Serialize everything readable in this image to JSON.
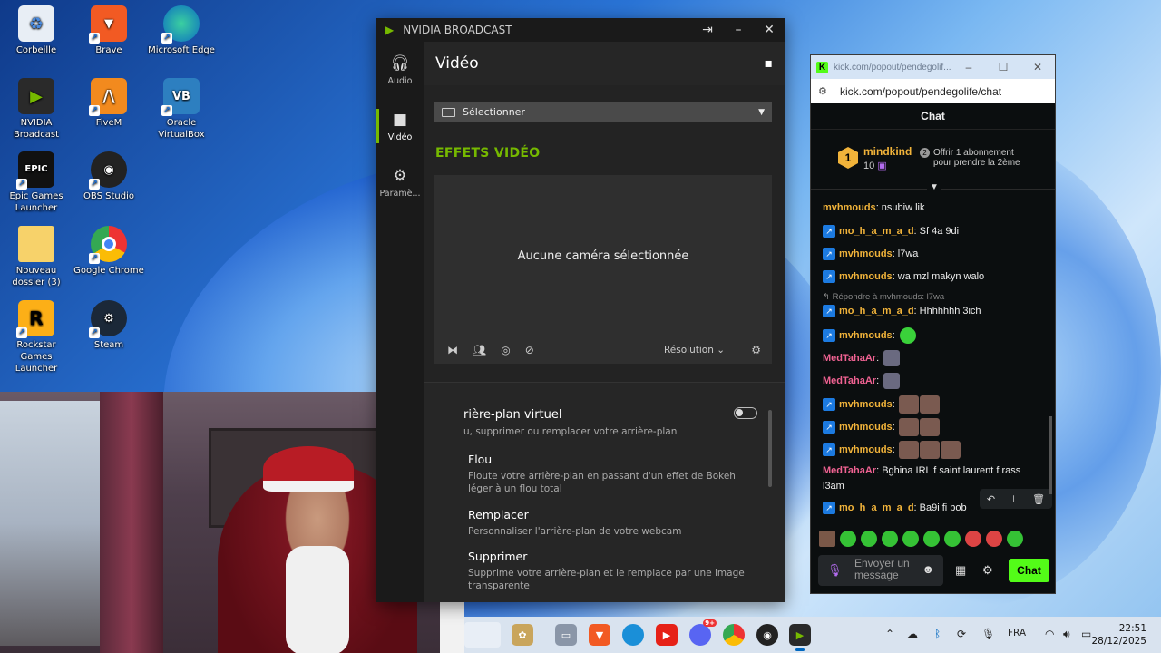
{
  "desktop": {
    "icons": [
      {
        "label": "Corbeille"
      },
      {
        "label": "Brave"
      },
      {
        "label": "Microsoft Edge"
      },
      {
        "label": "NVIDIA Broadcast"
      },
      {
        "label": "FiveM"
      },
      {
        "label": "Oracle VirtualBox"
      },
      {
        "label": "Epic Games Launcher"
      },
      {
        "label": "OBS Studio"
      },
      {
        "label": "Nouveau dossier (3)"
      },
      {
        "label": "Google Chrome"
      },
      {
        "label": "Rockstar Games Launcher"
      },
      {
        "label": "Steam"
      }
    ]
  },
  "nvidia": {
    "title": "NVIDIA BROADCAST",
    "nav": [
      {
        "label": "Audio",
        "icon": "headphones-icon"
      },
      {
        "label": "Vidéo",
        "icon": "camera-icon"
      },
      {
        "label": "Paramè...",
        "icon": "gear-icon"
      }
    ],
    "page_title": "Vidéo",
    "source_select": "Sélectionner",
    "section": "EFFETS VIDÉO",
    "no_camera": "Aucune caméra sélectionnée",
    "resolution": "Résolution",
    "bg_title": "rière-plan virtuel",
    "bg_sub": "u, supprimer ou remplacer votre arrière-plan",
    "options": [
      {
        "title": "Flou",
        "desc": "Floute votre arrière-plan en passant d'un effet de Bokeh léger à un flou total"
      },
      {
        "title": "Remplacer",
        "desc": "Personnaliser l'arrière-plan de votre webcam"
      },
      {
        "title": "Supprimer",
        "desc": "Supprime votre arrière-plan et le remplace par une image transparente"
      }
    ]
  },
  "kick": {
    "tab_title": "kick.com/popout/pendegolif...",
    "url": "kick.com/popout/pendegolife/chat",
    "chat_title": "Chat",
    "promo": {
      "rank": "1",
      "name": "mindkind",
      "count": "10",
      "gift_num": "2",
      "gift_line1": "Offrir 1 abonnement",
      "gift_line2": "pour prendre la 2ème"
    },
    "messages": [
      {
        "user": "mvhmouds",
        "text": " nsubiw lik",
        "color": "#f1b33a",
        "badge": false
      },
      {
        "user": "mo_h_a_m_a_d",
        "text": " Sf 4a 9di",
        "color": "#f1b33a",
        "badge": true
      },
      {
        "user": "mvhmouds",
        "text": " l7wa",
        "color": "#f1b33a",
        "badge": true
      },
      {
        "user": "mvhmouds",
        "text": " wa mzl makyn walo",
        "color": "#f1b33a",
        "badge": true
      },
      {
        "user": "mo_h_a_m_a_d",
        "text": " Hhhhhhh 3ich",
        "color": "#f1b33a",
        "badge": true
      },
      {
        "user": "mvhmouds",
        "text": "",
        "color": "#f1b33a",
        "badge": true
      },
      {
        "user": "MedTahaAr",
        "text": "",
        "color": "#f06292",
        "badge": false
      },
      {
        "user": "MedTahaAr",
        "text": "",
        "color": "#f06292",
        "badge": false
      },
      {
        "user": "mvhmouds",
        "text": "",
        "color": "#f1b33a",
        "badge": true
      },
      {
        "user": "mvhmouds",
        "text": "",
        "color": "#f1b33a",
        "badge": true
      },
      {
        "user": "mvhmouds",
        "text": "",
        "color": "#f1b33a",
        "badge": true
      },
      {
        "user": "MedTahaAr",
        "text": " Bghina IRL f saint laurent f rass",
        "color": "#f06292",
        "badge": false
      },
      {
        "user": "",
        "text": "l3am",
        "color": "#eee",
        "badge": false
      },
      {
        "user": "mo_h_a_m_a_d",
        "text": " Ba9i fi bob",
        "color": "#f1b33a",
        "badge": true
      }
    ],
    "reply_note": "Répondre à mvhmouds: l7wa",
    "input_placeholder": "Envoyer un message",
    "send_label": "Chat"
  },
  "taskbar": {
    "lang": "FRA",
    "time": "22:51",
    "date": "28/12/2025",
    "discord_badge": "9+"
  },
  "colors": {
    "nvidia_green": "#76b900",
    "kick_green": "#53fc18"
  }
}
